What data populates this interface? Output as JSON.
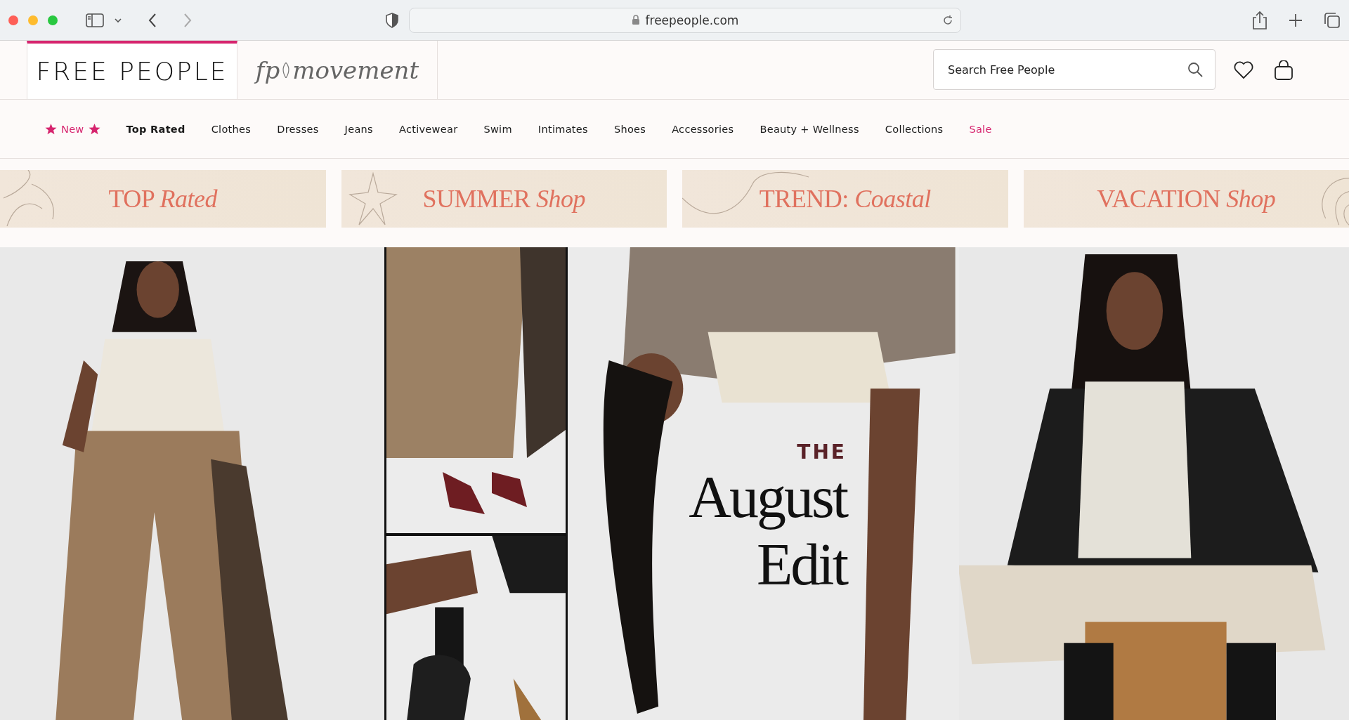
{
  "browser": {
    "url": "freepeople.com"
  },
  "header": {
    "logo": "FREE PEOPLE",
    "sub_brand": {
      "prefix": "fp",
      "name": "movement"
    },
    "search": {
      "placeholder": "Search Free People"
    }
  },
  "nav": [
    {
      "label": "New",
      "kind": "starred"
    },
    {
      "label": "Top Rated",
      "kind": "bold"
    },
    {
      "label": "Clothes",
      "kind": "plain"
    },
    {
      "label": "Dresses",
      "kind": "plain"
    },
    {
      "label": "Jeans",
      "kind": "plain"
    },
    {
      "label": "Activewear",
      "kind": "plain"
    },
    {
      "label": "Swim",
      "kind": "plain"
    },
    {
      "label": "Intimates",
      "kind": "plain"
    },
    {
      "label": "Shoes",
      "kind": "plain"
    },
    {
      "label": "Accessories",
      "kind": "plain"
    },
    {
      "label": "Beauty + Wellness",
      "kind": "plain"
    },
    {
      "label": "Collections",
      "kind": "plain"
    },
    {
      "label": "Sale",
      "kind": "sale"
    }
  ],
  "promo_banners": [
    {
      "label": "TOP *Rated*",
      "kind": "flower"
    },
    {
      "label": "SUMMER *Shop*",
      "kind": "starfish"
    },
    {
      "label": "TREND: *Coastal*",
      "kind": "lines"
    },
    {
      "label": "VACATION *Shop*",
      "kind": "shell"
    }
  ],
  "hero": {
    "kicker": "THE",
    "title_lines": [
      "August",
      "Edit"
    ]
  }
}
